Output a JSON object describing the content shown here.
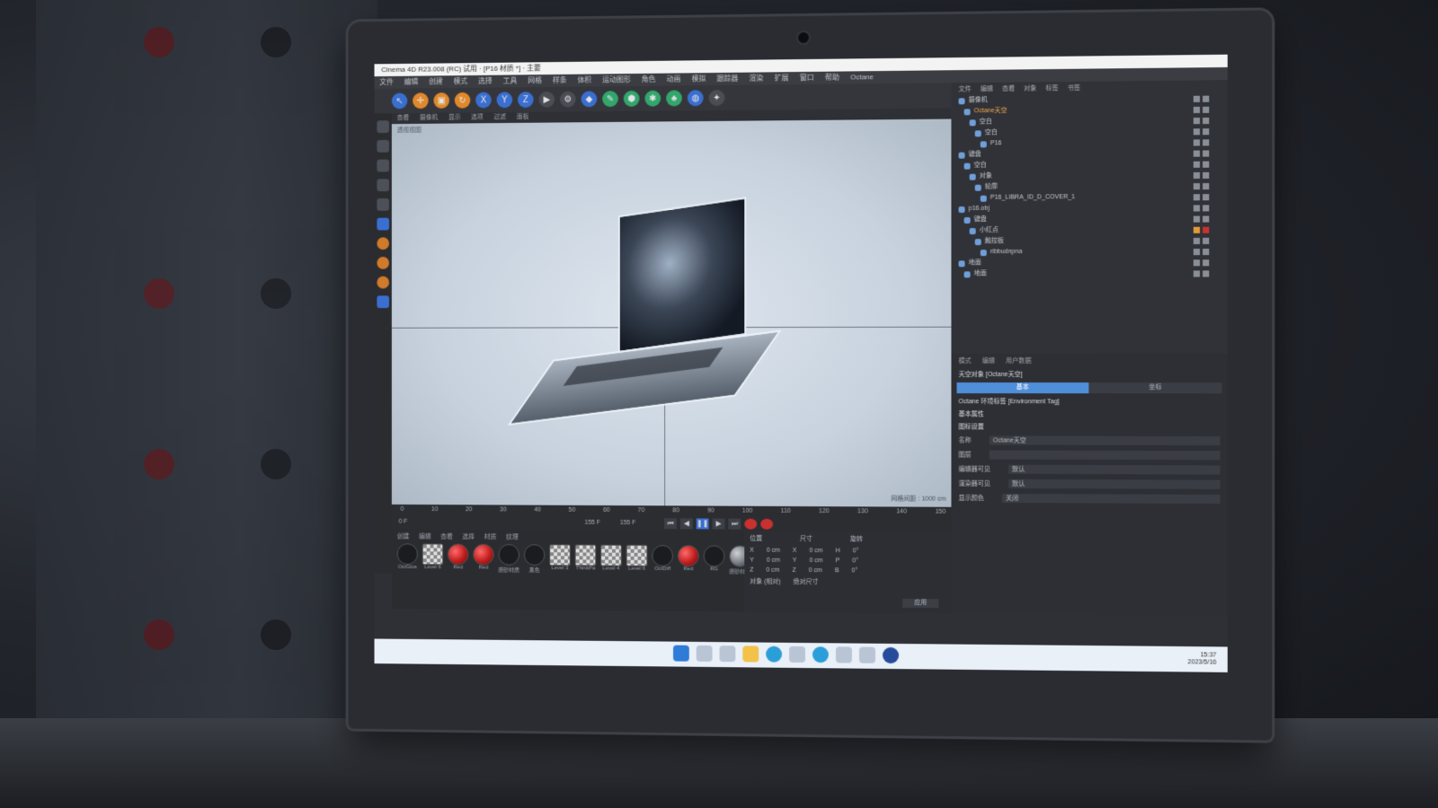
{
  "app": {
    "title": "Cinema 4D R23.008 (RC) 试用 · [P16 材质 *] · 主要",
    "menu": [
      "文件",
      "编辑",
      "创建",
      "模式",
      "选择",
      "工具",
      "网格",
      "样条",
      "体积",
      "运动图形",
      "角色",
      "动画",
      "模拟",
      "跟踪器",
      "渲染",
      "扩展",
      "窗口",
      "帮助",
      "Octane"
    ],
    "toolbar_axes": [
      "X",
      "Y",
      "Z"
    ],
    "viewport_menu": [
      "查看",
      "摄像机",
      "显示",
      "选项",
      "过滤",
      "面板"
    ],
    "viewport_label": "透视视图",
    "viewport_grid_text": "网格间距 : 1000 cm",
    "timeline_ticks": [
      "0",
      "10",
      "20",
      "30",
      "40",
      "50",
      "60",
      "70",
      "80",
      "90",
      "100",
      "110",
      "120",
      "130",
      "140",
      "150"
    ],
    "frame_start": "0 F",
    "frame_current": "155 F",
    "frame_end": "155 F",
    "materials_menu": [
      "创建",
      "编辑",
      "查看",
      "选择",
      "材质",
      "纹理"
    ],
    "materials": [
      {
        "name": "OctGlos",
        "kind": "black"
      },
      {
        "name": "Level 6",
        "kind": "check"
      },
      {
        "name": "Red",
        "kind": "red"
      },
      {
        "name": "Red",
        "kind": "red"
      },
      {
        "name": "磨砂材质",
        "kind": "black"
      },
      {
        "name": "黑色",
        "kind": "black"
      },
      {
        "name": "Level 3",
        "kind": "check"
      },
      {
        "name": "ThinkPa",
        "kind": "check"
      },
      {
        "name": "Level 4",
        "kind": "check"
      },
      {
        "name": "Level 6",
        "kind": "check"
      },
      {
        "name": "OctDiff",
        "kind": "black"
      },
      {
        "name": "Red",
        "kind": "red"
      },
      {
        "name": "RG",
        "kind": "black"
      },
      {
        "name": "磨砂材质",
        "kind": "grey"
      }
    ],
    "coords_header": [
      "位置",
      "尺寸",
      "旋转"
    ],
    "coords_rows": [
      {
        "axis": "X",
        "pos": "0 cm",
        "size": "0 cm",
        "rot_label": "H",
        "rot": "0°"
      },
      {
        "axis": "Y",
        "pos": "0 cm",
        "size": "0 cm",
        "rot_label": "P",
        "rot": "0°"
      },
      {
        "axis": "Z",
        "pos": "0 cm",
        "size": "0 cm",
        "rot_label": "B",
        "rot": "0°"
      }
    ],
    "coords_mode": "对象 (相对)",
    "coords_size_mode": "绝对尺寸",
    "coords_apply": "应用",
    "objmgr_menu": [
      "文件",
      "编辑",
      "查看",
      "对象",
      "标签",
      "书签"
    ],
    "objects": [
      {
        "label": "摄像机",
        "selected": false
      },
      {
        "label": "Octane天空",
        "selected": true
      },
      {
        "label": "空白",
        "selected": false
      },
      {
        "label": "空白",
        "selected": false
      },
      {
        "label": "P16",
        "selected": false
      },
      {
        "label": "键盘",
        "selected": false
      },
      {
        "label": "空白",
        "selected": false
      },
      {
        "label": "对象",
        "selected": false
      },
      {
        "label": "轮廓",
        "selected": false
      },
      {
        "label": "P16_LIBRA_ID_D_COVER_1",
        "selected": false
      },
      {
        "label": "p16.obj",
        "selected": false
      },
      {
        "label": "键盘",
        "selected": false
      },
      {
        "label": "小红点",
        "selected": false
      },
      {
        "label": "触控板",
        "selected": false
      },
      {
        "label": "ribbudnpna",
        "selected": false
      },
      {
        "label": "地面",
        "selected": false
      },
      {
        "label": "地面",
        "selected": false
      }
    ],
    "attr_tabs": [
      "模式",
      "编辑",
      "用户数据"
    ],
    "attr_title": "天空对象 [Octane天空]",
    "attr_modes": [
      "基本",
      "坐标"
    ],
    "attr_tag": "Octane 环境标签 [Environment Tag]",
    "attr_section": "基本属性",
    "attr_subsection": "图标设置",
    "attr_fields": [
      {
        "label": "名称",
        "value": "Octane天空"
      },
      {
        "label": "图层",
        "value": ""
      },
      {
        "label": "编辑器可见",
        "value": "默认"
      },
      {
        "label": "渲染器可见",
        "value": "默认"
      },
      {
        "label": "显示颜色",
        "value": "关闭"
      }
    ],
    "tray_time": "15:37",
    "tray_date": "2023/5/16"
  }
}
